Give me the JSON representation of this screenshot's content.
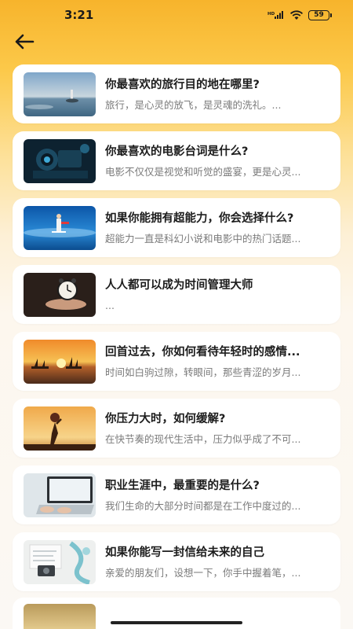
{
  "status_bar": {
    "time": "3:21",
    "battery": "59"
  },
  "articles": [
    {
      "title": "你最喜欢的旅行目的地在哪里?",
      "subtitle": "旅行，是心灵的放飞，是灵魂的洗礼。...",
      "image": "seaside-lighthouse"
    },
    {
      "title": "你最喜欢的电影台词是什么?",
      "subtitle": "电影不仅仅是视觉和听觉的盛宴，更是心灵...",
      "image": "film-camera"
    },
    {
      "title": "如果你能拥有超能力，你会选择什么?",
      "subtitle": "超能力一直是科幻小说和电影中的热门话题...",
      "image": "flying-hero"
    },
    {
      "title": "人人都可以成为时间管理大师",
      "subtitle": "...",
      "image": "hand-alarm-clock"
    },
    {
      "title": "回首过去，你如何看待年轻时的感情...",
      "subtitle": "时间如白驹过隙，转眼间，那些青涩的岁月...",
      "image": "sunset-sailboats"
    },
    {
      "title": "你压力大时，如何缓解?",
      "subtitle": "在快节奏的现代生活中，压力似乎成了不可...",
      "image": "sunset-silhouette"
    },
    {
      "title": "职业生涯中，最重要的是什么?",
      "subtitle": "我们生命的大部分时间都是在工作中度过的...",
      "image": "laptop-typing"
    },
    {
      "title": "如果你能写一封信给未来的自己",
      "subtitle": "亲爱的朋友们，设想一下，你手中握着笔，...",
      "image": "letter-camera"
    }
  ],
  "colors": {
    "header_top": "#f7b42c",
    "background": "#fbf8f4",
    "card": "#ffffff",
    "title_text": "#1c1c1c",
    "subtitle_text": "#7a7a7a"
  }
}
